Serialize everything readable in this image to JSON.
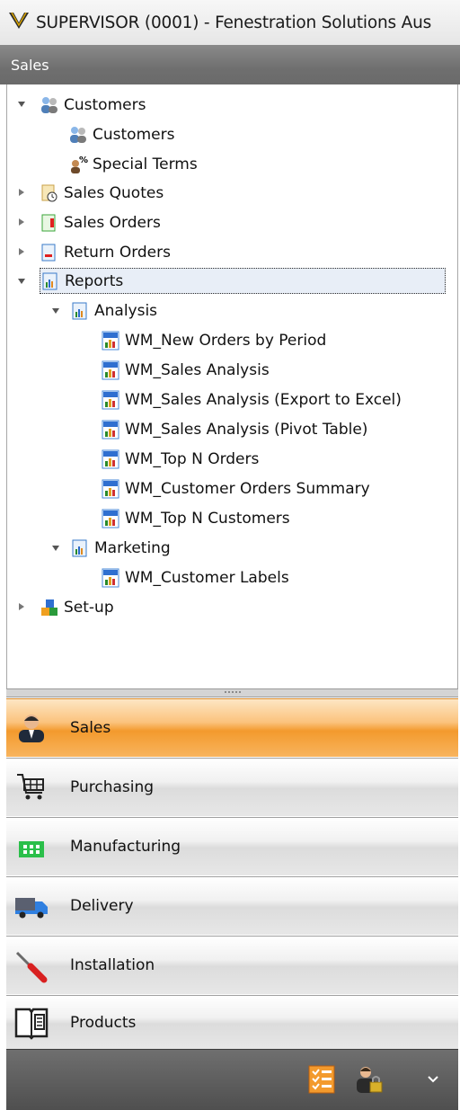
{
  "window": {
    "title": "SUPERVISOR (0001) - Fenestration Solutions Aus"
  },
  "section": {
    "title": "Sales"
  },
  "tree": {
    "customers": {
      "label": "Customers",
      "children": [
        "Customers",
        "Special Terms"
      ]
    },
    "sales_quotes": "Sales Quotes",
    "sales_orders": "Sales Orders",
    "return_orders": "Return Orders",
    "reports": {
      "label": "Reports",
      "analysis": {
        "label": "Analysis",
        "items": [
          "WM_New Orders by Period",
          "WM_Sales Analysis",
          "WM_Sales Analysis (Export to Excel)",
          "WM_Sales Analysis (Pivot Table)",
          "WM_Top N Orders",
          "WM_Customer Orders Summary",
          "WM_Top N Customers"
        ]
      },
      "marketing": {
        "label": "Marketing",
        "items": [
          "WM_Customer Labels"
        ]
      }
    },
    "setup": "Set-up"
  },
  "nav": {
    "items": [
      "Sales",
      "Purchasing",
      "Manufacturing",
      "Delivery",
      "Installation",
      "Products"
    ],
    "active": "Sales"
  },
  "icons": {
    "app": "window-app-icon",
    "customers": "customers-icon",
    "special_terms": "special-terms-icon",
    "sales_quotes": "sales-quotes-icon",
    "sales_orders": "sales-orders-icon",
    "return_orders": "return-orders-icon",
    "reports": "reports-icon",
    "report_item": "wm-report-icon",
    "setup": "setup-icon",
    "nav": [
      "sales-icon",
      "cart-icon",
      "factory-icon",
      "truck-icon",
      "screwdriver-icon",
      "book-icon"
    ],
    "bottom": [
      "checklist-icon",
      "user-lock-icon",
      "chevron-down-icon"
    ]
  },
  "colors": {
    "active_nav": "#f39a2d",
    "header": "#6f6f6f",
    "selection": "#e8eef7"
  }
}
